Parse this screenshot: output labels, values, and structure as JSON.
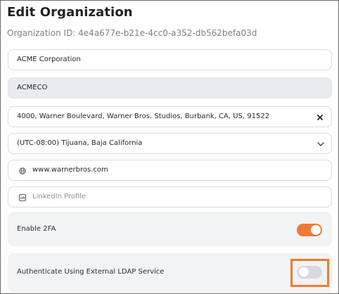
{
  "title": "Edit Organization",
  "org_id_text": "Organization ID: 4e4a677e-b21e-4cc0-a352-db562befa03d",
  "fields": {
    "name": {
      "value": "ACME Corporation"
    },
    "short_name": {
      "value": "ACMECO"
    },
    "address": {
      "value": "4000, Warner Boulevard, Warner Bros. Studios, Burbank, CA, US, 91522"
    },
    "timezone": {
      "value": "(UTC-08:00) Tijuana, Baja California"
    },
    "website": {
      "value": "www.warnerbros.com"
    },
    "linkedin": {
      "placeholder": "LinkedIn Profile"
    }
  },
  "settings": {
    "enable_2fa": {
      "label": "Enable 2FA",
      "state": "on"
    },
    "ldap": {
      "label": "Authenticate Using External LDAP Service",
      "state": "off"
    }
  },
  "colors": {
    "accent": "#f07a36",
    "highlight": "#ef7c2f"
  },
  "icons": {
    "website": "globe-icon",
    "linkedin": "linkedin-icon",
    "clear": "close-icon",
    "dropdown": "chevron-down-icon"
  }
}
